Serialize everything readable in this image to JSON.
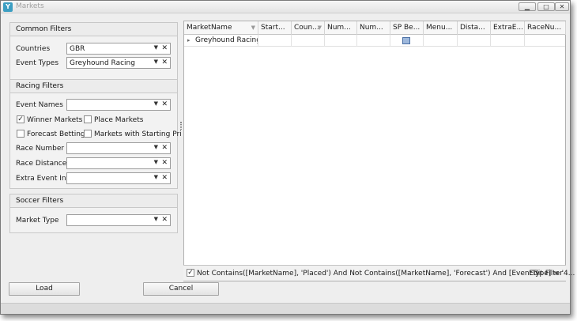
{
  "window": {
    "title": "Markets",
    "app_icon": "app-icon",
    "minimize_glyph": "▁",
    "maximize_glyph": "□",
    "close_glyph": "✕"
  },
  "common_filters": {
    "header": "Common Filters",
    "countries_label": "Countries",
    "countries_value": "GBR",
    "event_types_label": "Event Types",
    "event_types_value": "Greyhound Racing"
  },
  "racing_filters": {
    "header": "Racing Filters",
    "event_names_label": "Event Names",
    "event_names_value": "",
    "winner_markets_label": "Winner Markets",
    "winner_markets_checked": true,
    "place_markets_label": "Place Markets",
    "place_markets_checked": false,
    "forecast_betting_label": "Forecast Betting",
    "forecast_betting_checked": false,
    "starting_price_label": "Markets with Starting Pri",
    "starting_price_checked": false,
    "race_number_label": "Race Number",
    "race_number_value": "",
    "race_distance_label": "Race Distance",
    "race_distance_value": "",
    "extra_event_info_label": "Extra Event Info",
    "extra_event_info_value": ""
  },
  "soccer_filters": {
    "header": "Soccer Filters",
    "market_type_label": "Market Type",
    "market_type_value": ""
  },
  "grid": {
    "columns": [
      "MarketName",
      "Start...",
      "Coun...",
      "Num...",
      "Num...",
      "SP Be...",
      "Menu...",
      "Dista...",
      "ExtraE...",
      "RaceNu..."
    ],
    "rows": [
      {
        "market_name": "Greyhound Racing",
        "sp_betting": "grid-icon"
      }
    ]
  },
  "filter_bar": {
    "enabled": true,
    "expression": "Not Contains([MarketName], 'Placed') And Not Contains([MarketName], 'Forecast') And [EventType] = '4...",
    "edit_label": "Edit Filter"
  },
  "buttons": {
    "load": "Load",
    "cancel": "Cancel"
  },
  "glyphs": {
    "dropdown": "▼",
    "clear": "✕",
    "check": "✓",
    "expand": "▸",
    "filter": "▼"
  }
}
